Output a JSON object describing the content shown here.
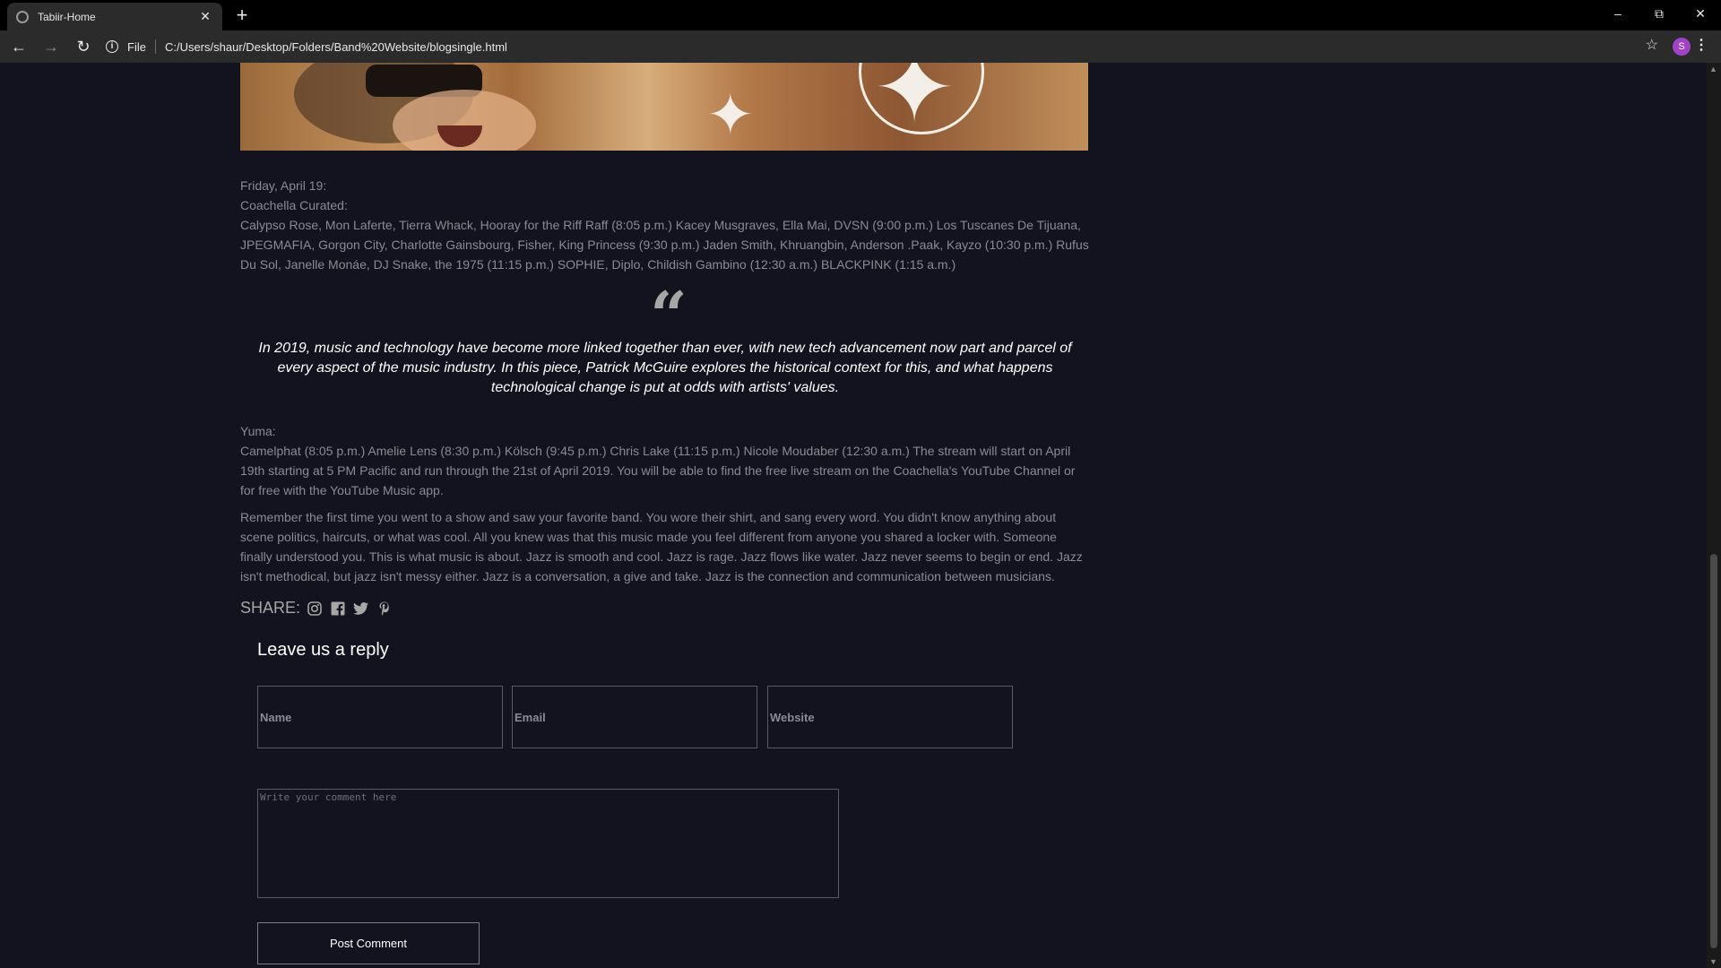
{
  "browser": {
    "tab_title": "Tabiir-Home",
    "file_label": "File",
    "url": "C:/Users/shaur/Desktop/Folders/Band%20Website/blogsingle.html",
    "profile_initial": "S"
  },
  "article": {
    "friday_lines": [
      "Friday, April 19:",
      "Coachella Curated:",
      "Calypso Rose, Mon Laferte, Tierra Whack, Hooray for the Riff Raff (8:05 p.m.) Kacey Musgraves, Ella Mai, DVSN (9:00 p.m.) Los Tuscanes De Tijuana, JPEGMAFIA, Gorgon City, Charlotte Gainsbourg, Fisher, King Princess (9:30 p.m.) Jaden Smith, Khruangbin, Anderson .Paak, Kayzo (10:30 p.m.) Rufus Du Sol, Janelle Monáe, DJ Snake, the 1975 (11:15 p.m.) SOPHIE, Diplo, Childish Gambino (12:30 a.m.) BLACKPINK (1:15 a.m.)"
    ],
    "quote": "In 2019, music and technology have become more linked together than ever, with new tech advancement now part and parcel of every aspect of the music industry. In this piece, Patrick McGuire explores the historical context for this, and what happens technological change is put at odds with artists' values.",
    "yuma_lines": [
      "Yuma:",
      "Camelphat (8:05 p.m.) Amelie Lens (8:30 p.m.) Kölsch (9:45 p.m.) Chris Lake (11:15 p.m.) Nicole Moudaber (12:30 a.m.) The stream will start on April 19th starting at 5 PM Pacific and run through the 21st of April 2019. You will be able to find the free live stream on the Coachella's YouTube Channel or for free with the YouTube Music app."
    ],
    "closing": "Remember the first time you went to a show and saw your favorite band. You wore their shirt, and sang every word. You didn't know anything about scene politics, haircuts, or what was cool. All you knew was that this music made you feel different from anyone you shared a locker with. Someone finally understood you. This is what music is about. Jazz is smooth and cool. Jazz is rage. Jazz flows like water. Jazz never seems to begin or end. Jazz isn't methodical, but jazz isn't messy either. Jazz is a conversation, a give and take. Jazz is the connection and communication between musicians.",
    "share_label": "SHARE:",
    "share_icons": [
      "instagram-icon",
      "facebook-icon",
      "twitter-icon",
      "pinterest-icon"
    ]
  },
  "reply": {
    "title": "Leave us a reply",
    "name_placeholder": "Name",
    "email_placeholder": "Email",
    "website_placeholder": "Website",
    "comment_placeholder": "Write your comment here",
    "submit_label": "Post Comment"
  }
}
